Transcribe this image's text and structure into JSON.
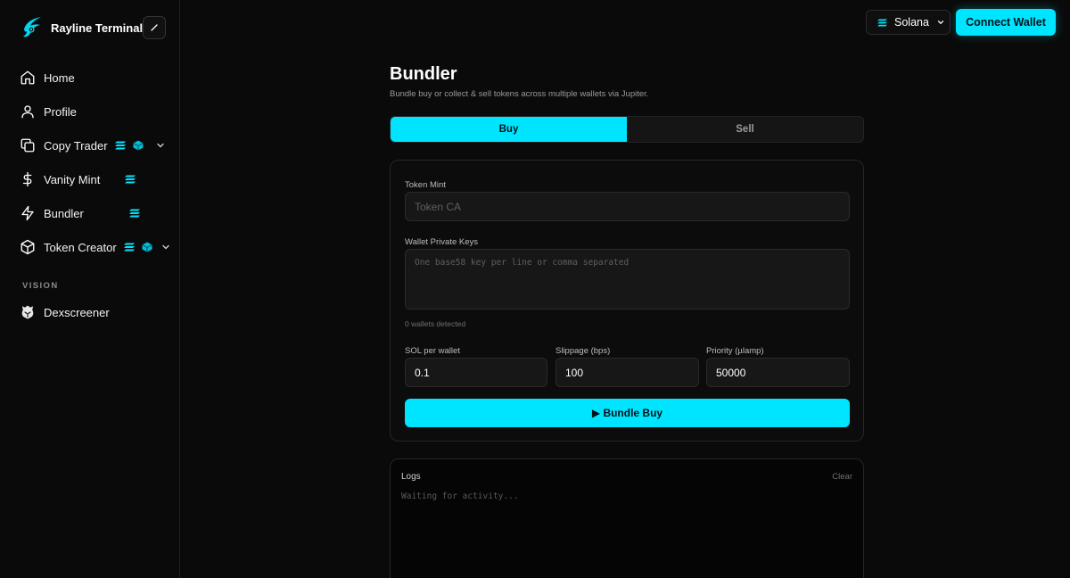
{
  "app": {
    "brand_name": "Rayline Terminal",
    "accent_color": "#00e5ff"
  },
  "sidebar": {
    "items": [
      {
        "label": "Home",
        "icon": "home-icon"
      },
      {
        "label": "Profile",
        "icon": "user-icon"
      },
      {
        "label": "Copy Trader",
        "icon": "copy-icon",
        "badges": [
          "solana-icon",
          "cube-icon"
        ],
        "expandable": true
      },
      {
        "label": "Vanity Mint",
        "icon": "dollar-icon",
        "badges": [
          "solana-icon"
        ]
      },
      {
        "label": "Bundler",
        "icon": "bolt-icon",
        "badges": [
          "solana-icon"
        ]
      },
      {
        "label": "Token Creator",
        "icon": "box-icon",
        "badges": [
          "solana-icon",
          "cube-icon"
        ],
        "expandable": true
      }
    ],
    "section_label": "VISION",
    "section_items": [
      {
        "label": "Dexscreener",
        "icon": "dexscreener-icon"
      }
    ]
  },
  "topbar": {
    "chain_label": "Solana",
    "connect_label": "Connect Wallet"
  },
  "page": {
    "title": "Bundler",
    "subtitle": "Bundle buy or collect & sell tokens across multiple wallets via Jupiter.",
    "tabs": [
      {
        "label": "Buy",
        "active": true
      },
      {
        "label": "Sell",
        "active": false
      }
    ]
  },
  "form": {
    "token_mint_label": "Token Mint",
    "token_mint_placeholder": "Token CA",
    "keys_label": "Wallet Private Keys",
    "keys_placeholder": "One base58 key per line or comma separated",
    "wallets_detected": "0 wallets detected",
    "sol_label": "SOL per wallet",
    "sol_value": "0.1",
    "slippage_label": "Slippage (bps)",
    "slippage_value": "100",
    "priority_label": "Priority (µlamp)",
    "priority_value": "50000",
    "submit_label": "▶ Bundle Buy"
  },
  "logs": {
    "title": "Logs",
    "clear_label": "Clear",
    "empty_text": "Waiting for activity..."
  }
}
